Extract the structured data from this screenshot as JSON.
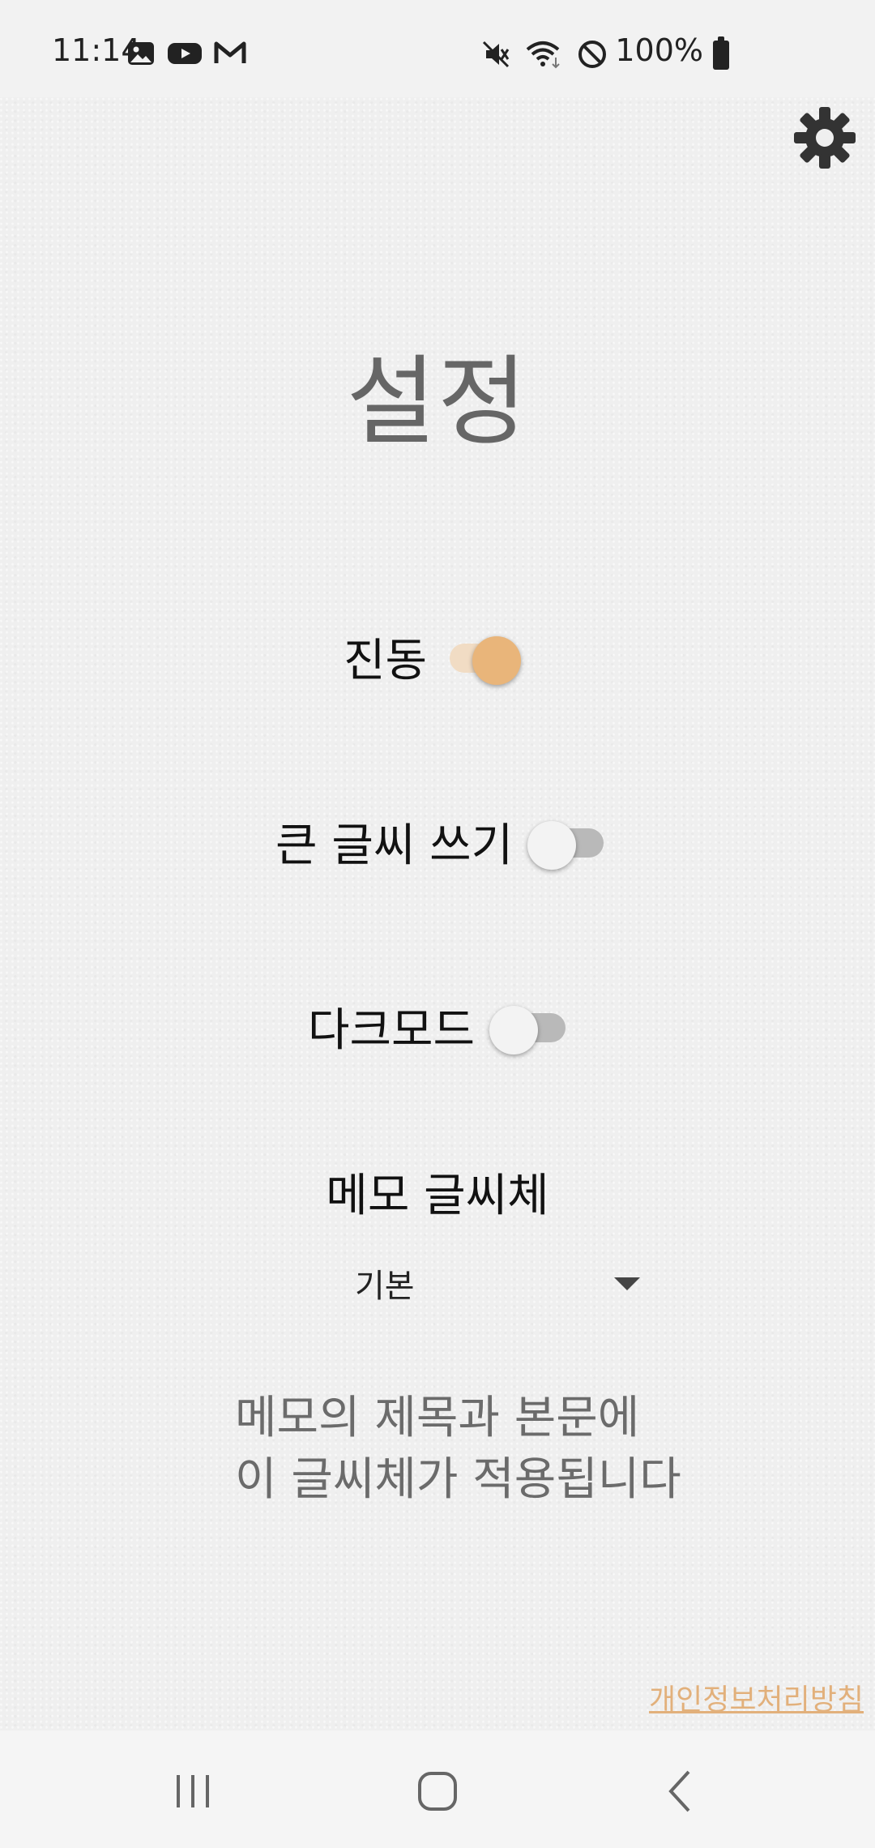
{
  "status_bar": {
    "time": "11:14",
    "battery_text": "100%",
    "left_icons": [
      "gallery-icon",
      "youtube-icon",
      "gmail-icon"
    ],
    "right_icons": [
      "mute-icon",
      "wifi-icon",
      "dnd-icon",
      "battery-icon"
    ]
  },
  "page": {
    "title": "설정"
  },
  "settings": {
    "vibration": {
      "label": "진동",
      "on": true
    },
    "large_text": {
      "label": "큰 글씨 쓰기",
      "on": false
    },
    "dark_mode": {
      "label": "다크모드",
      "on": false
    }
  },
  "font": {
    "label": "메모 글씨체",
    "selected": "기본",
    "description_line1": "메모의 제목과 본문에",
    "description_line2": "이 글씨체가 적용됩니다"
  },
  "footer": {
    "privacy_link": "개인정보처리방침"
  },
  "colors": {
    "accent": "#e9b57a",
    "accent_track": "#f1dcc4",
    "link": "#e2b07b"
  },
  "nav": {
    "items": [
      "recents-icon",
      "home-icon",
      "back-icon"
    ]
  }
}
